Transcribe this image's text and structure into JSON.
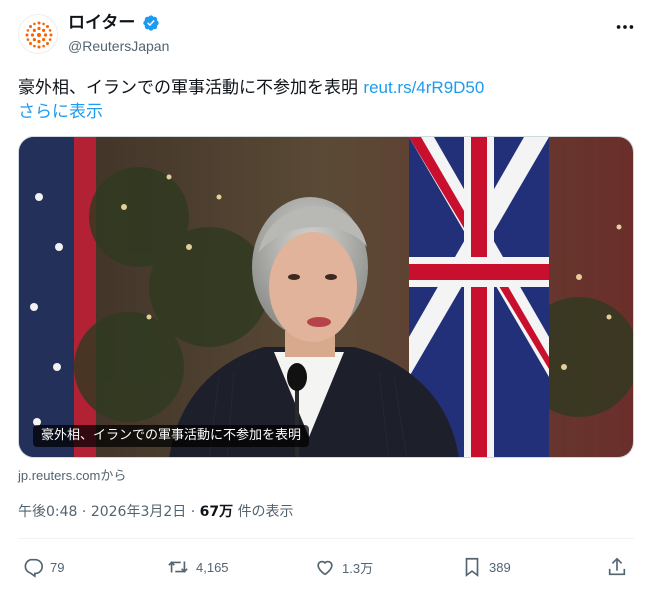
{
  "account": {
    "display_name": "ロイター",
    "handle": "@ReutersJapan",
    "avatar_icon": "reuters-logo-icon",
    "verified_icon": "verified-badge-icon",
    "verified_color": "#1d9bf0"
  },
  "tweet": {
    "text": "豪外相、イランでの軍事活動に不参加を表明",
    "link": "reut.rs/4rR9D50",
    "show_more": "さらに表示"
  },
  "media": {
    "caption": "豪外相、イランでの軍事活動に不参加を表明",
    "source": "jp.reuters.comから"
  },
  "meta": {
    "time": "午後0:48",
    "separator": "·",
    "date": "2026年3月2日",
    "views_count": "67万",
    "views_label": "件の表示"
  },
  "actions": {
    "reply": {
      "icon": "reply-icon",
      "count": "79"
    },
    "retweet": {
      "icon": "retweet-icon",
      "count": "4,165"
    },
    "like": {
      "icon": "heart-icon",
      "count": "1.3万"
    },
    "bookmark": {
      "icon": "bookmark-icon",
      "count": "389"
    },
    "share": {
      "icon": "share-icon"
    }
  },
  "colors": {
    "text": "#0f1419",
    "muted": "#536471",
    "link": "#1d9bf0",
    "brand": "#fa6400"
  }
}
